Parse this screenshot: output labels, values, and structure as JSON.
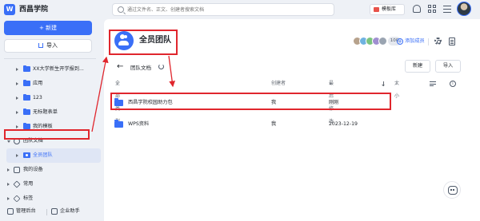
{
  "topbar": {
    "app_name": "西昌学院",
    "search_placeholder": "通过文件名、正文、创建者搜索文档",
    "template_label": "模板库"
  },
  "sidebar": {
    "new_label": "+ 新建",
    "import_label": "导入",
    "tree": [
      {
        "label": "XX大学新生开学报到...",
        "kind": "folder"
      },
      {
        "label": "应用",
        "kind": "folder"
      },
      {
        "label": "123",
        "kind": "folder"
      },
      {
        "label": "无标题表单",
        "kind": "folder"
      },
      {
        "label": "我的模板",
        "kind": "folder"
      },
      {
        "label": "团队文档",
        "kind": "section"
      },
      {
        "label": "全员团队",
        "kind": "team"
      },
      {
        "label": "我的设备",
        "kind": "section"
      },
      {
        "label": "常用",
        "kind": "section"
      },
      {
        "label": "标签",
        "kind": "section"
      }
    ],
    "bottom": {
      "admin_label": "管理后台",
      "assistant_label": "企业助手"
    }
  },
  "main": {
    "team_name": "全员团队",
    "member_count": "100",
    "add_member_label": "添加成员",
    "breadcrumb": "团队文档",
    "new_label": "新建",
    "import_label": "导入",
    "columns": {
      "type": "全部类型",
      "creator": "创建者",
      "modified": "最后修改",
      "size": "大小"
    },
    "rows": [
      {
        "name": "西昌学院校园助力包",
        "creator": "我",
        "modified": "刚刚"
      },
      {
        "name": "WPS资料",
        "creator": "我",
        "modified": "2023-12-19"
      }
    ]
  },
  "colors": {
    "accent": "#3a6ff7",
    "annotation": "#e0262d"
  }
}
